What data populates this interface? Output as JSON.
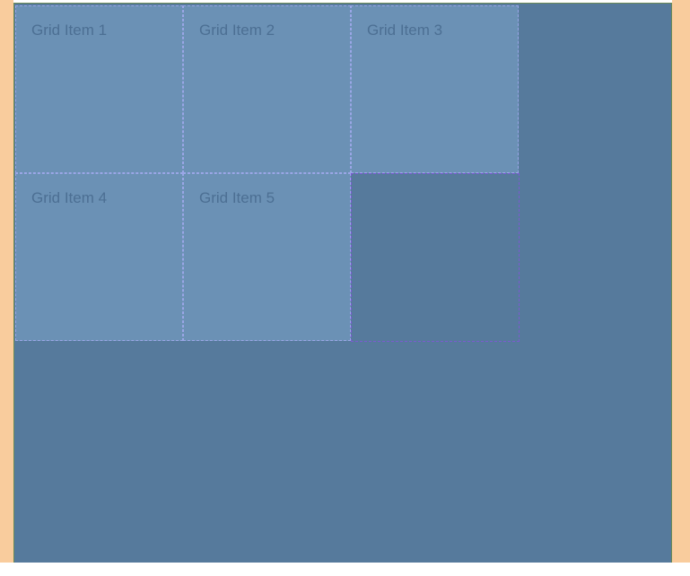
{
  "grid": {
    "items": [
      {
        "label": "Grid Item 1"
      },
      {
        "label": "Grid Item 2"
      },
      {
        "label": "Grid Item 3"
      },
      {
        "label": "Grid Item 4"
      },
      {
        "label": "Grid Item 5"
      }
    ]
  },
  "colors": {
    "side_margin": "#f9cc9d",
    "container_bg": "#567a9c",
    "item_bg": "#6b91b5",
    "item_text": "#4c6f93",
    "item_border": "#9aa6e6",
    "empty_track_border": "#7a5bd0"
  }
}
